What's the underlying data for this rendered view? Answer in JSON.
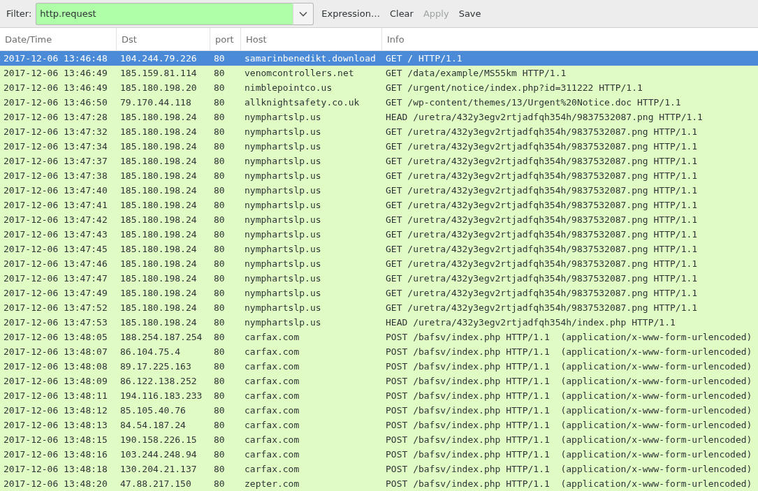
{
  "filter_bar": {
    "label": "Filter:",
    "value": "http.request",
    "valid": true,
    "buttons": [
      {
        "label": "Expression…",
        "disabled": false
      },
      {
        "label": "Clear",
        "disabled": false
      },
      {
        "label": "Apply",
        "disabled": true
      },
      {
        "label": "Save",
        "disabled": false
      }
    ]
  },
  "table": {
    "columns": [
      "Date/Time",
      "Dst",
      "port",
      "Host",
      "Info"
    ],
    "rows": [
      {
        "selected": true,
        "cells": [
          "2017-12-06 13:46:48",
          "104.244.79.226",
          "80",
          "samarinbenedikt.download",
          "GET / HTTP/1.1"
        ]
      },
      {
        "selected": false,
        "cells": [
          "2017-12-06 13:46:49",
          "185.159.81.114",
          "80",
          "venomcontrollers.net",
          "GET /data/example/MS55km HTTP/1.1"
        ]
      },
      {
        "selected": false,
        "cells": [
          "2017-12-06 13:46:49",
          "185.180.198.20",
          "80",
          "nimblepointco.us",
          "GET /urgent/notice/index.php?id=311222 HTTP/1.1"
        ]
      },
      {
        "selected": false,
        "cells": [
          "2017-12-06 13:46:50",
          "79.170.44.118",
          "80",
          "allknightsafety.co.uk",
          "GET /wp-content/themes/13/Urgent%20Notice.doc HTTP/1.1"
        ]
      },
      {
        "selected": false,
        "cells": [
          "2017-12-06 13:47:28",
          "185.180.198.24",
          "80",
          "nymphartslp.us",
          "HEAD /uretra/432y3egv2rtjadfqh354h/9837532087.png HTTP/1.1"
        ]
      },
      {
        "selected": false,
        "cells": [
          "2017-12-06 13:47:32",
          "185.180.198.24",
          "80",
          "nymphartslp.us",
          "GET /uretra/432y3egv2rtjadfqh354h/9837532087.png HTTP/1.1"
        ]
      },
      {
        "selected": false,
        "cells": [
          "2017-12-06 13:47:34",
          "185.180.198.24",
          "80",
          "nymphartslp.us",
          "GET /uretra/432y3egv2rtjadfqh354h/9837532087.png HTTP/1.1"
        ]
      },
      {
        "selected": false,
        "cells": [
          "2017-12-06 13:47:37",
          "185.180.198.24",
          "80",
          "nymphartslp.us",
          "GET /uretra/432y3egv2rtjadfqh354h/9837532087.png HTTP/1.1"
        ]
      },
      {
        "selected": false,
        "cells": [
          "2017-12-06 13:47:38",
          "185.180.198.24",
          "80",
          "nymphartslp.us",
          "GET /uretra/432y3egv2rtjadfqh354h/9837532087.png HTTP/1.1"
        ]
      },
      {
        "selected": false,
        "cells": [
          "2017-12-06 13:47:40",
          "185.180.198.24",
          "80",
          "nymphartslp.us",
          "GET /uretra/432y3egv2rtjadfqh354h/9837532087.png HTTP/1.1"
        ]
      },
      {
        "selected": false,
        "cells": [
          "2017-12-06 13:47:41",
          "185.180.198.24",
          "80",
          "nymphartslp.us",
          "GET /uretra/432y3egv2rtjadfqh354h/9837532087.png HTTP/1.1"
        ]
      },
      {
        "selected": false,
        "cells": [
          "2017-12-06 13:47:42",
          "185.180.198.24",
          "80",
          "nymphartslp.us",
          "GET /uretra/432y3egv2rtjadfqh354h/9837532087.png HTTP/1.1"
        ]
      },
      {
        "selected": false,
        "cells": [
          "2017-12-06 13:47:43",
          "185.180.198.24",
          "80",
          "nymphartslp.us",
          "GET /uretra/432y3egv2rtjadfqh354h/9837532087.png HTTP/1.1"
        ]
      },
      {
        "selected": false,
        "cells": [
          "2017-12-06 13:47:45",
          "185.180.198.24",
          "80",
          "nymphartslp.us",
          "GET /uretra/432y3egv2rtjadfqh354h/9837532087.png HTTP/1.1"
        ]
      },
      {
        "selected": false,
        "cells": [
          "2017-12-06 13:47:46",
          "185.180.198.24",
          "80",
          "nymphartslp.us",
          "GET /uretra/432y3egv2rtjadfqh354h/9837532087.png HTTP/1.1"
        ]
      },
      {
        "selected": false,
        "cells": [
          "2017-12-06 13:47:47",
          "185.180.198.24",
          "80",
          "nymphartslp.us",
          "GET /uretra/432y3egv2rtjadfqh354h/9837532087.png HTTP/1.1"
        ]
      },
      {
        "selected": false,
        "cells": [
          "2017-12-06 13:47:49",
          "185.180.198.24",
          "80",
          "nymphartslp.us",
          "GET /uretra/432y3egv2rtjadfqh354h/9837532087.png HTTP/1.1"
        ]
      },
      {
        "selected": false,
        "cells": [
          "2017-12-06 13:47:52",
          "185.180.198.24",
          "80",
          "nymphartslp.us",
          "GET /uretra/432y3egv2rtjadfqh354h/9837532087.png HTTP/1.1"
        ]
      },
      {
        "selected": false,
        "cells": [
          "2017-12-06 13:47:53",
          "185.180.198.24",
          "80",
          "nymphartslp.us",
          "HEAD /uretra/432y3egv2rtjadfqh354h/index.php HTTP/1.1"
        ]
      },
      {
        "selected": false,
        "cells": [
          "2017-12-06 13:48:05",
          "188.254.187.254",
          "80",
          "carfax.com",
          "POST /bafsv/index.php HTTP/1.1  (application/x-www-form-urlencoded)"
        ]
      },
      {
        "selected": false,
        "cells": [
          "2017-12-06 13:48:07",
          "86.104.75.4",
          "80",
          "carfax.com",
          "POST /bafsv/index.php HTTP/1.1  (application/x-www-form-urlencoded)"
        ]
      },
      {
        "selected": false,
        "cells": [
          "2017-12-06 13:48:08",
          "89.17.225.163",
          "80",
          "carfax.com",
          "POST /bafsv/index.php HTTP/1.1  (application/x-www-form-urlencoded)"
        ]
      },
      {
        "selected": false,
        "cells": [
          "2017-12-06 13:48:09",
          "86.122.138.252",
          "80",
          "carfax.com",
          "POST /bafsv/index.php HTTP/1.1  (application/x-www-form-urlencoded)"
        ]
      },
      {
        "selected": false,
        "cells": [
          "2017-12-06 13:48:11",
          "194.116.183.233",
          "80",
          "carfax.com",
          "POST /bafsv/index.php HTTP/1.1  (application/x-www-form-urlencoded)"
        ]
      },
      {
        "selected": false,
        "cells": [
          "2017-12-06 13:48:12",
          "85.105.40.76",
          "80",
          "carfax.com",
          "POST /bafsv/index.php HTTP/1.1  (application/x-www-form-urlencoded)"
        ]
      },
      {
        "selected": false,
        "cells": [
          "2017-12-06 13:48:13",
          "84.54.187.24",
          "80",
          "carfax.com",
          "POST /bafsv/index.php HTTP/1.1  (application/x-www-form-urlencoded)"
        ]
      },
      {
        "selected": false,
        "cells": [
          "2017-12-06 13:48:15",
          "190.158.226.15",
          "80",
          "carfax.com",
          "POST /bafsv/index.php HTTP/1.1  (application/x-www-form-urlencoded)"
        ]
      },
      {
        "selected": false,
        "cells": [
          "2017-12-06 13:48:16",
          "103.244.248.94",
          "80",
          "carfax.com",
          "POST /bafsv/index.php HTTP/1.1  (application/x-www-form-urlencoded)"
        ]
      },
      {
        "selected": false,
        "cells": [
          "2017-12-06 13:48:18",
          "130.204.21.137",
          "80",
          "carfax.com",
          "POST /bafsv/index.php HTTP/1.1  (application/x-www-form-urlencoded)"
        ]
      },
      {
        "selected": false,
        "cells": [
          "2017-12-06 13:48:20",
          "47.88.217.150",
          "80",
          "zepter.com",
          "POST /bafsv/index.php HTTP/1.1  (application/x-www-form-urlencoded)"
        ]
      }
    ]
  }
}
